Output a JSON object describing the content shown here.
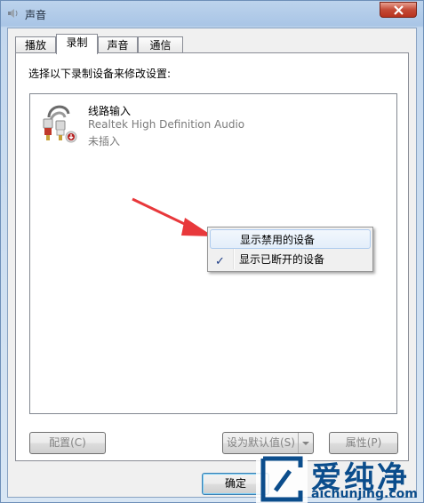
{
  "window": {
    "title": "声音"
  },
  "tabs": [
    {
      "label": "播放"
    },
    {
      "label": "录制"
    },
    {
      "label": "声音"
    },
    {
      "label": "通信"
    }
  ],
  "panel": {
    "instruction": "选择以下录制设备来修改设置:"
  },
  "device": {
    "name": "线路输入",
    "driver": "Realtek High Definition Audio",
    "status": "未插入"
  },
  "context_menu": {
    "items": [
      {
        "label": "显示禁用的设备",
        "checked": false
      },
      {
        "label": "显示已断开的设备",
        "checked": true
      }
    ],
    "check_glyph": "✓"
  },
  "buttons": {
    "configure": "配置(C)",
    "set_default": "设为默认值(S)",
    "properties": "属性(P)",
    "ok": "确定"
  },
  "watermark": {
    "brand": "爱纯净",
    "url": "aichunjing.com"
  },
  "colors": {
    "annotation_arrow": "#e8383b",
    "watermark": "#0b4d8c"
  }
}
